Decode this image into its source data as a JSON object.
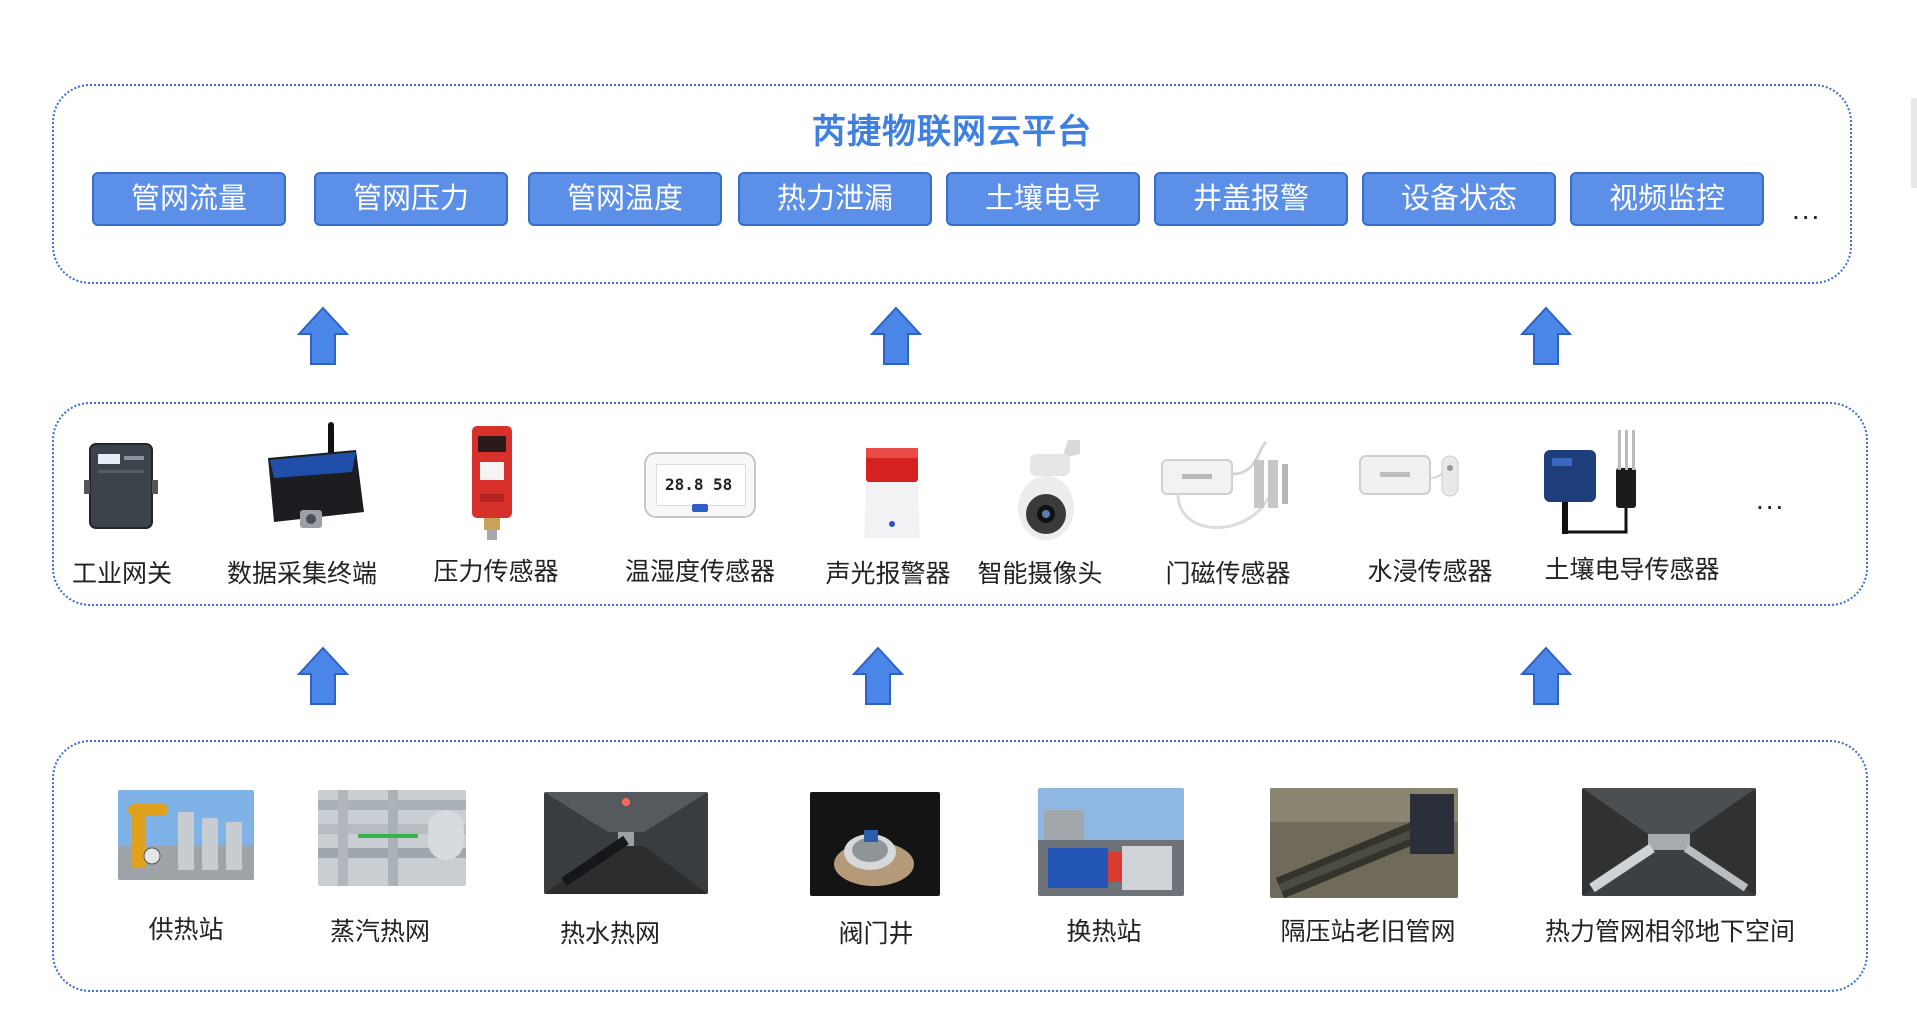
{
  "platform": {
    "title": "芮捷物联网云平台",
    "functions": [
      "管网流量",
      "管网压力",
      "管网温度",
      "热力泄漏",
      "土壤电导",
      "井盖报警",
      "设备状态",
      "视频监控"
    ],
    "more": "..."
  },
  "devices": {
    "items": [
      {
        "name": "工业网关",
        "icon": "gateway-icon"
      },
      {
        "name": "数据采集终端",
        "icon": "data-terminal-icon"
      },
      {
        "name": "压力传感器",
        "icon": "pressure-sensor-icon"
      },
      {
        "name": "温湿度传感器",
        "icon": "temp-humidity-sensor-icon",
        "display_left": "28.8",
        "display_right": "58"
      },
      {
        "name": "声光报警器",
        "icon": "alarm-icon"
      },
      {
        "name": "智能摄像头",
        "icon": "camera-icon"
      },
      {
        "name": "门磁传感器",
        "icon": "door-sensor-icon"
      },
      {
        "name": "水浸传感器",
        "icon": "water-sensor-icon"
      },
      {
        "name": "土壤电导传感器",
        "icon": "soil-conductivity-sensor-icon"
      }
    ],
    "more": "..."
  },
  "scenes": {
    "items": [
      {
        "name": "供热站"
      },
      {
        "name": "蒸汽热网"
      },
      {
        "name": "热水热网"
      },
      {
        "name": "阀门井"
      },
      {
        "name": "换热站"
      },
      {
        "name": "隔压站老旧管网"
      },
      {
        "name": "热力管网相邻地下空间"
      }
    ]
  },
  "colors": {
    "accent": "#3f7fe0",
    "chip_fill": "#5b8fe8",
    "chip_border": "#3a6cc9",
    "panel_border": "#3b6fd1",
    "arrow_fill": "#4a86e8"
  }
}
